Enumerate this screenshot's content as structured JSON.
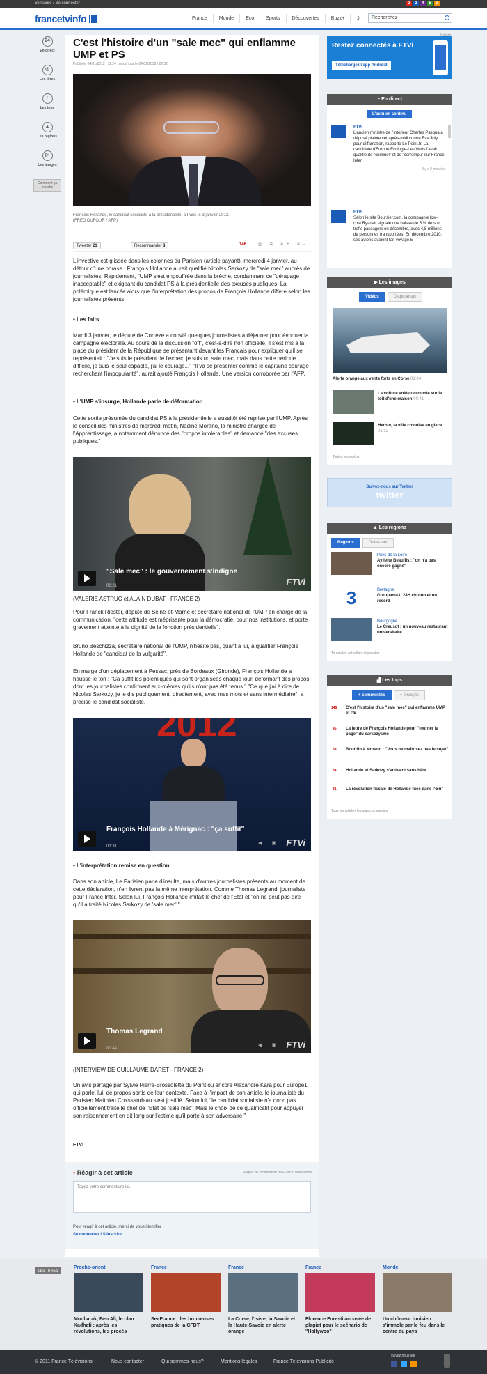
{
  "topbar": {
    "auth": "S'inscrire / Se connecter",
    "channels": [
      "2",
      "3",
      "4",
      "5",
      "o"
    ]
  },
  "header": {
    "logo": "francetvinfo",
    "nav": [
      "France",
      "Monde",
      "Eco",
      "Sports",
      "Découvertes",
      "Buzz+",
      ":)"
    ],
    "search_value": "Recherchez"
  },
  "pub_label": "Publicité",
  "leftnav": [
    {
      "icon": "24",
      "label": "En direct"
    },
    {
      "icon": "◎",
      "label": "Les titres"
    },
    {
      "icon": "↑",
      "label": "Les tops"
    },
    {
      "icon": "▲",
      "label": "Les régions"
    },
    {
      "icon": "▷",
      "label": "Les images"
    },
    {
      "icon": "",
      "label": "Comment ça marche"
    }
  ],
  "article": {
    "title": "C'est l'histoire d'un \"sale mec\" qui enflamme UMP et PS",
    "pubdate": "Publié le 04/01/2012 | 11:24 , mis à jour le 04/01/2012 | 22:32",
    "caption": "Francois Hollande, le candidat socialiste à la présidentielle, à Paris le 3 janvier 2012.",
    "credit": "(FRED DUFOUR / AFP)",
    "share": {
      "tweet": "Tweeter",
      "tweet_count": "21",
      "fb": "Recommander",
      "fb_count": "8",
      "comments": "146",
      "font_tools": "A+ A-"
    },
    "p1": "L'invective est glissée dans les colonnes du Parisien (article payant), mercredi 4 janvier, au détour d'une phrase : François Hollande aurait qualifié Nicolas Sarkozy de \"sale mec\" auprès de journalistes. Rapidement, l'UMP s'est engouffrée dans la brèche, condamnant ce \"dérapage inacceptable\" et exigeant du candidat PS à la présidentielle des excuses publiques. La polémique est lancée alors que l'interprétation des propos de François Hollande diffère selon les journalistes présents.",
    "h_faits": "• Les faits",
    "p2": "Mardi 3 janvier, le député de Corrèze a convié quelques journalistes à déjeuner pour évoquer la campagne électorale. Au cours de la discussion \"off\", c'est-à-dire non officielle, il s'est mis à la place du président de la République se présentant devant les Français pour expliquer qu'il se représentait : \"Je suis le président de l'échec, je suis un sale mec, mais dans cette période difficile, je suis le seul capable, j'ai le courage...\" \"Il va se présenter comme le capitaine courage recherchant l'impopularité\", aurait ajouté François Hollande. Une version corroborée par l'AFP.",
    "h_ump": "• L'UMP s'insurge, Hollande parle de déformation",
    "p3": "Cette sortie présumée du candidat PS à la présidentielle a aussitôt été reprise par l'UMP. Après le conseil des ministres de mercredi matin, Nadine Morano, la ministre chargée de l'Apprentissage, a notamment dénoncé des \"propos intolérables\" et demandé \"des excuses publiques.\"",
    "video1": {
      "title": "\"Sale mec\" : le gouvernement s'indigne",
      "duration": "00:21",
      "logo": "FTVi"
    },
    "v1cap": "(VALERIE ASTRUC et ALAIN DUBAT - FRANCE 2)",
    "p4": "Pour Franck Riester, député de Seine-et-Marne et secrétaire national de l'UMP en charge de la communication, \"cette attitude est méprisante pour la démocratie, pour nos institutions, et porte gravement atteinte à la dignité de la fonction présidentielle\".",
    "p5": "Bruno Beschizza, secrétaire national de l'UMP, n'hésite pas, quant à lui, à qualifier François Hollande de \"candidat de la vulgarité\".",
    "p6": "En marge d'un déplacement à Pessac, près de Bordeaux (Gironde), François Hollande a haussé le ton : \"Ça suffit les polémiques qui sont organisées chaque jour, déformant des propos dont les journalistes confirment eux-mêmes qu'ils n'ont pas été tenus.\" \"Ce que j'ai à dire de Nicolas Sarkozy, je le dis publiquement, directement, avec mes mots et sans intermédiaire\", a précisé le candidat socialiste.",
    "video2": {
      "title": "François Hollande à Mérignac : \"ça suffit\"",
      "duration": "01:31",
      "logo": "FTVi",
      "banner": "2012"
    },
    "h_interp": "• L'interprétation remise en question",
    "p7": "Dans son article, Le Parisien parle d'insulte, mais d'autres journalistes présents au moment de cette déclaration, n'en livrent pas la même interprétation. Comme Thomas Legrand, journaliste pour France Inter. Selon lui, François Hollande imitait le chef de l'Etat et \"on ne peut pas dire qu'il a traité Nicolas Sarkozy de 'sale mec'.\"",
    "video3": {
      "title": "Thomas Legrand",
      "duration": "00:44",
      "logo": "FTVi"
    },
    "v3cap": "(INTERVIEW DE GUILLAUME DARET - FRANCE 2)",
    "p8": "Un avis partagé par Sylvie Pierre-Brossolette du Point ou encore Alexandre Kara pour Europe1, qui parle, lui, de propos sortis de leur contexte. Face à l'impact de son article, le journaliste du Parisien Matthieu Croissandeau s'est justifié. Selon lui, \"le candidat socialiste n'a donc pas officiellement traité le chef de l'Etat de 'sale mec'. Mais le choix de ce qualificatif pour appuyer son raisonnement en dit long sur l'estime qu'il porte à son adversaire.\"",
    "sign": "FTVi"
  },
  "comment": {
    "title": "Réagir à cet article",
    "rules": "Règles de modération de France Télévisions",
    "placeholder": "Tapez votre commentaire ici.",
    "note": "Pour réagir à cet article, merci de vous identifier",
    "connect": "Se connecter / S'inscrire"
  },
  "promo": {
    "title": "Restez connectés à FTVi",
    "button": "Téléchargez l'app Android"
  },
  "direct": {
    "title": "En direct",
    "btn": "L'actu en continu",
    "items": [
      {
        "src": "FTVi",
        "text": "L'ancien ministre de l'Intérieur Charles Pasqua a déposé plainte cet après-midi contre Eva Joly pour diffamation, rapporte Le Point.fr. La candidate d'Europe Ecologie-Les Verts l'avait qualifié de \"criminel\" et de \"corrompu\" sur France Inter.",
        "time": "Il y a 8 minutes"
      },
      {
        "src": "FTVi",
        "text": "Selon le site Boursier.com, la compagnie low-cost Ryanair signale une baisse de 5 % de son trafic passagers en décembre, avec 4,8 millions de personnes transportées. En décembre 2010, ses avions avaient fait voyagé 5"
      }
    ]
  },
  "images": {
    "title": "Les images",
    "tabs": [
      "Vidéos",
      "Diaporamas"
    ],
    "main": "Alerte orange aux vents forts en Corse",
    "main_time": "01:04",
    "items": [
      {
        "text": "La voiture volée retrouvée sur le toit d'une maison",
        "time": "00:41"
      },
      {
        "text": "Herbin, la ville chinoise en glace",
        "time": "01:12"
      }
    ],
    "all": "Toutes les vidéos"
  },
  "twitter": {
    "label": "Suivez-nous sur Twitter",
    "logo": "twitter"
  },
  "regions": {
    "title": "Les régions",
    "tabs": [
      "Régions",
      "Outre-mer"
    ],
    "items": [
      {
        "region": "Pays de la Loire",
        "text": "Ayliette Beaufils : \"on n'a pas encore gagné\""
      },
      {
        "region": "Bretagne",
        "text": "Groupama3: 24H chrono et un record"
      },
      {
        "region": "Bourgogne",
        "text": "Le Creusot : un nouveau restaurant universitaire"
      }
    ],
    "all": "Toutes les actualités régionales"
  },
  "tops": {
    "title": "Les tops",
    "tabs": [
      "+ commentés",
      "+ envoyés"
    ],
    "items": [
      {
        "n": "146",
        "text": "C'est l'histoire d'un \"sale mec\" qui enflamme UMP et PS"
      },
      {
        "n": "46",
        "text": "La lettre de François Hollande pour \"tourner la page\" du sarkozysme"
      },
      {
        "n": "38",
        "text": "Bourdin à Morano : \"Vous ne maîtrisez pas le sujet\""
      },
      {
        "n": "34",
        "text": "Hollande et Sarkozy s'activent sans hâte"
      },
      {
        "n": "31",
        "text": "La révolution fiscale de Hollande tuée dans l'œuf"
      }
    ],
    "all": "Tous les articles les plus commentés"
  },
  "footer": {
    "badge": "LES TITRES",
    "cols": [
      {
        "cat": "Proche-orient",
        "text": "Moubarak, Ben Ali, le clan Kadhafi : après les révolutions, les procès"
      },
      {
        "cat": "France",
        "text": "SeaFrance : les brumeuses pratiques de la CFDT"
      },
      {
        "cat": "France",
        "text": "La Corse, l'Isère, la Savoie et la Haute-Savoie en alerte orange"
      },
      {
        "cat": "France",
        "text": "Florence Foresti accusée de plagiat pour le scénario de \"Hollywoo\""
      },
      {
        "cat": "Monde",
        "text": "Un chômeur tunisien s'immole par le feu dans le centre du pays"
      }
    ]
  },
  "bottom": {
    "links": [
      "© 2011 France Télévisions",
      "Nous contacter",
      "Qui sommes-nous?",
      "Mentions légales",
      "France Télévisions Publicité"
    ],
    "follow": "suivez nous sur"
  }
}
